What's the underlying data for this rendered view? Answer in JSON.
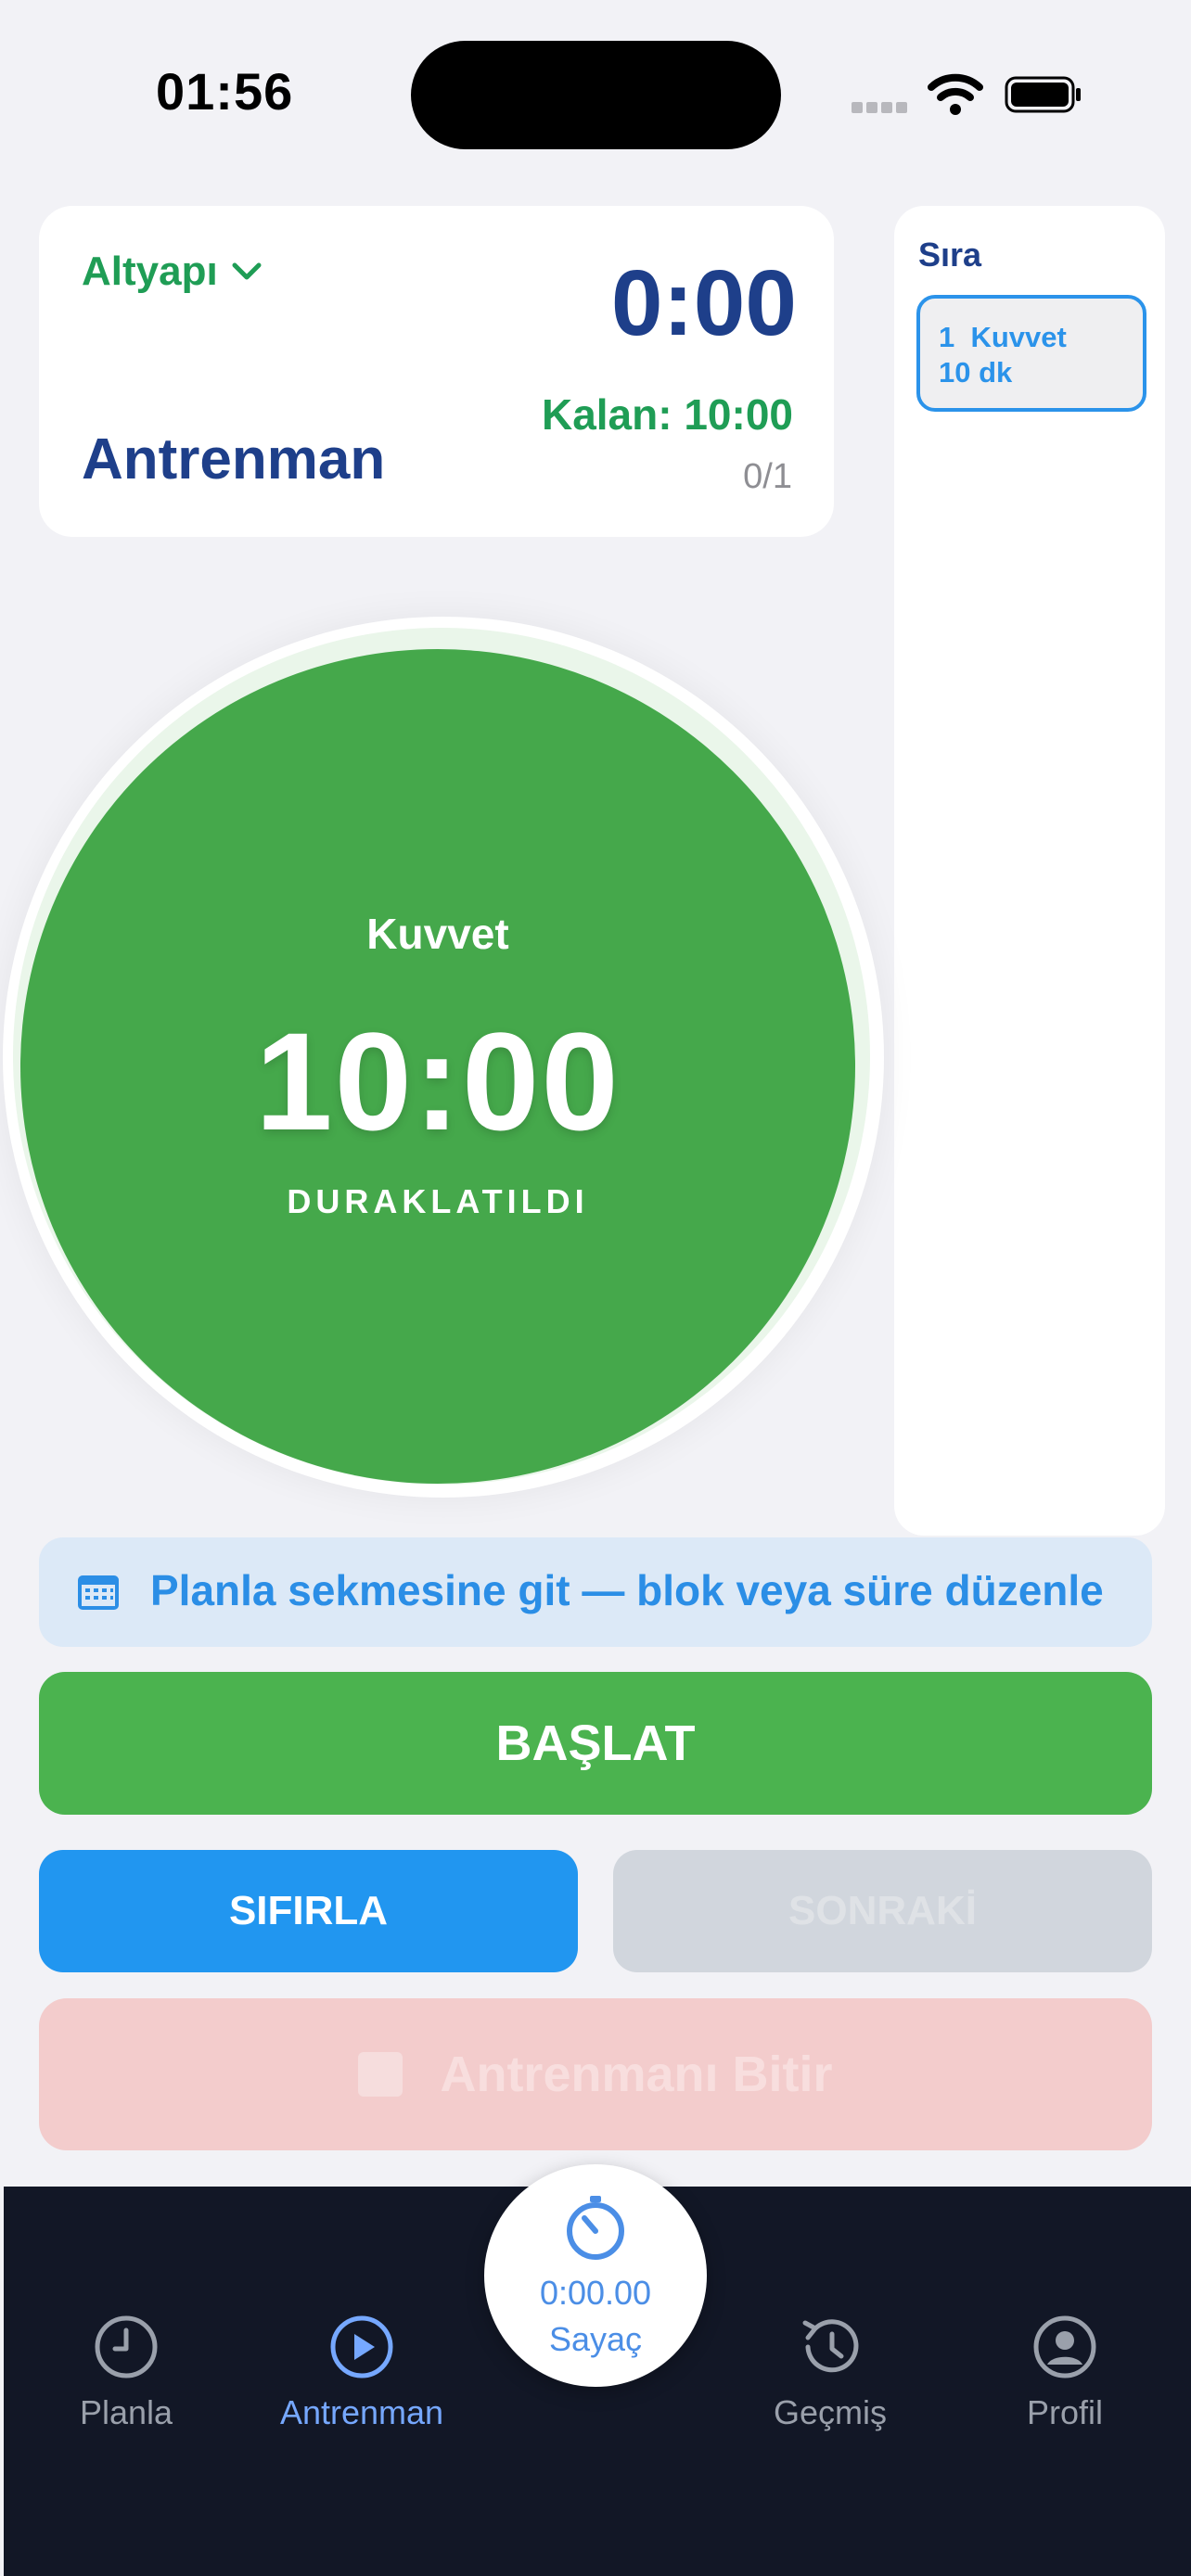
{
  "status_bar": {
    "time": "01:56"
  },
  "header": {
    "mode_label": "Altyapı",
    "elapsed": "0:00",
    "title": "Antrenman",
    "remaining_prefix": "Kalan:",
    "remaining_value": "10:00",
    "progress": "0/1"
  },
  "queue": {
    "title": "Sıra",
    "items": [
      {
        "index": "1",
        "name": "Kuvvet",
        "duration": "10 dk"
      }
    ]
  },
  "timer": {
    "block_name": "Kuvvet",
    "countdown": "10:00",
    "state": "DURAKLATILDI"
  },
  "plan_link": {
    "text": "Planla sekmesine git — blok veya süre düzenle"
  },
  "buttons": {
    "start": "BAŞLAT",
    "reset": "SIFIRLA",
    "next": "SONRAKİ",
    "finish": "Antrenmanı Bitir"
  },
  "tabbar": {
    "plan": "Planla",
    "train": "Antrenman",
    "history": "Geçmiş",
    "profile": "Profil",
    "fab_time": "0:00.00",
    "fab_label": "Sayaç"
  },
  "colors": {
    "accent_green": "#45a84b",
    "navy": "#1e3f8a",
    "blue": "#2196f0",
    "tabbar_bg": "#121726"
  }
}
